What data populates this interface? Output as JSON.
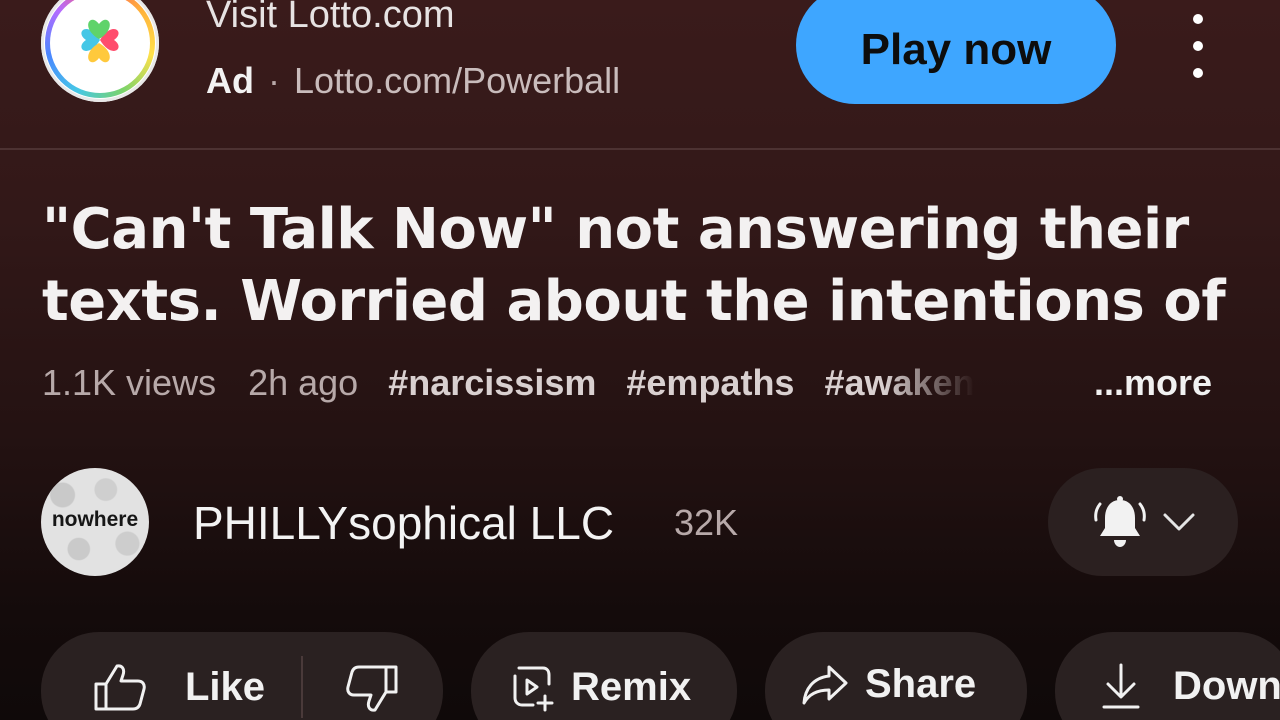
{
  "ad": {
    "title": "Visit Lotto.com",
    "tag": "Ad",
    "separator": "·",
    "url": "Lotto.com/Powerball",
    "cta": "Play now",
    "logo_icon": "clover-icon"
  },
  "video": {
    "title_line1": "\"Can't Talk Now\" not answering their",
    "title_line2": "texts. Worried about the intentions of t...",
    "views": "1.1K views",
    "age": "2h ago",
    "tags": [
      "#narcissism",
      "#empaths",
      "#awaken"
    ],
    "more": "...more"
  },
  "channel": {
    "avatar_text": "nowhere",
    "name": "PHILLYsophical LLC",
    "subscribers": "32K"
  },
  "actions": {
    "like": "Like",
    "remix": "Remix",
    "share": "Share",
    "download": "Down"
  },
  "colors": {
    "accent": "#3ea6ff",
    "background_top": "#3a1b1b",
    "background_bottom": "#0f0909",
    "pill": "#2a2121"
  }
}
